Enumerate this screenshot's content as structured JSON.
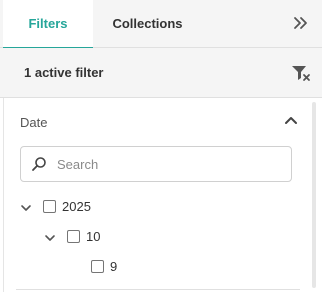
{
  "tabs": {
    "filters_label": "Filters",
    "collections_label": "Collections",
    "active": "Filters",
    "accent_color": "#26a69a"
  },
  "header": {
    "collapse_icon": "double-chevron-right-icon"
  },
  "active_filters": {
    "text": "1 active filter",
    "clear_icon": "filter-clear-icon"
  },
  "facet": {
    "title": "Date",
    "expanded": true,
    "search": {
      "value": "",
      "placeholder": "Search"
    },
    "tree": [
      {
        "label": "2025",
        "checked": false,
        "expanded": true
      },
      {
        "label": "10",
        "checked": false,
        "expanded": true
      },
      {
        "label": "9",
        "checked": false
      }
    ]
  }
}
